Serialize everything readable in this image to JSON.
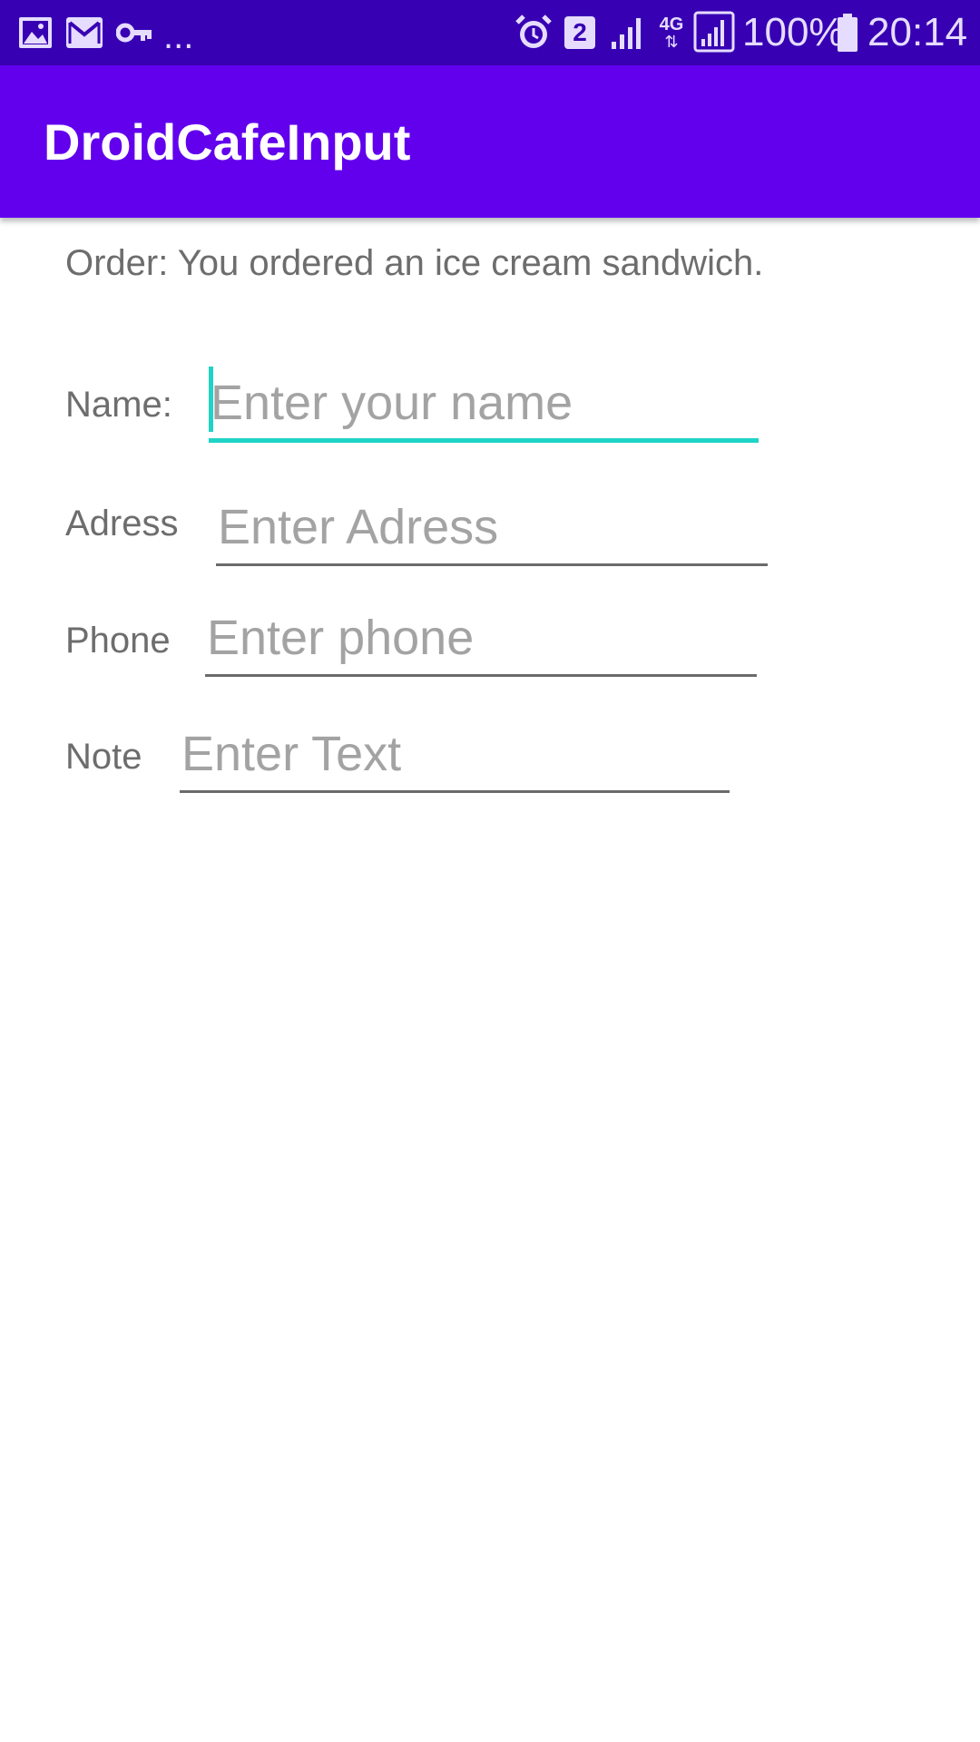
{
  "status_bar": {
    "left_icons": [
      "gallery-icon",
      "mail-icon",
      "key-icon"
    ],
    "overflow": "...",
    "sim_badge": "2",
    "network_type": "4G",
    "battery_percent": "100%",
    "time": "20:14",
    "background_color": "#3700b3"
  },
  "app_bar": {
    "title": "DroidCafeInput",
    "background_color": "#6200ee"
  },
  "order": {
    "text": "Order: You ordered an ice cream sandwich."
  },
  "form": {
    "name": {
      "label": "Name:",
      "placeholder": "Enter your name",
      "value": ""
    },
    "address": {
      "label": "Adress",
      "placeholder": "Enter Adress",
      "value": ""
    },
    "phone": {
      "label": "Phone",
      "placeholder": "Enter phone",
      "value": ""
    },
    "note": {
      "label": "Note",
      "placeholder": "Enter Text",
      "value": ""
    }
  },
  "accent_color": "#1fd3c6"
}
